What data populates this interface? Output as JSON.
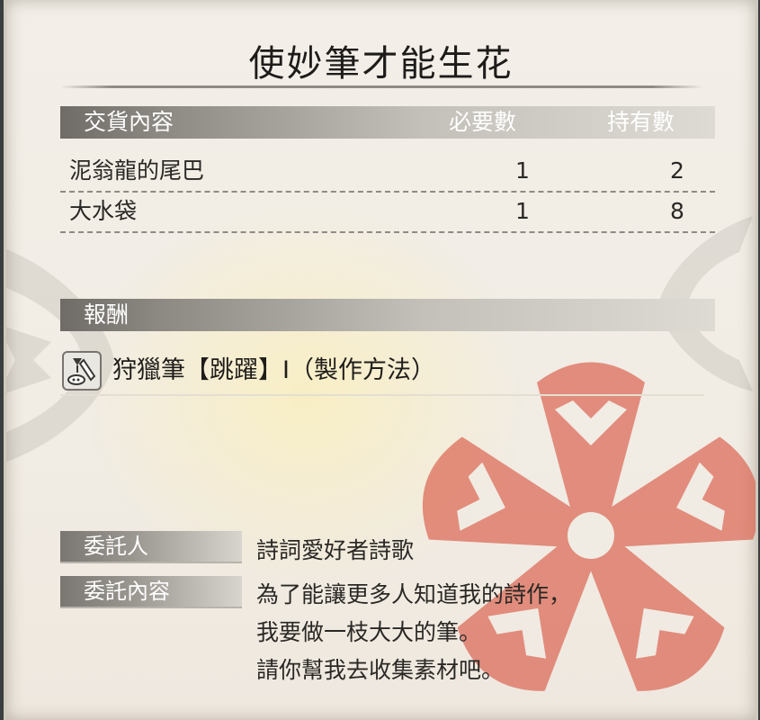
{
  "quest": {
    "title": "使妙筆才能生花"
  },
  "delivery": {
    "header_item": "交貨內容",
    "header_required": "必要數",
    "header_owned": "持有數",
    "rows": [
      {
        "item": "泥翁龍的尾巴",
        "required": "1",
        "owned": "2"
      },
      {
        "item": "大水袋",
        "required": "1",
        "owned": "8"
      }
    ]
  },
  "reward": {
    "header": "報酬",
    "item": "狩獵筆【跳躍】Ⅰ（製作方法）",
    "icon": "brush-recipe-icon"
  },
  "client": {
    "label": "委託人",
    "value": "詩詞愛好者詩歌"
  },
  "request": {
    "label": "委託內容",
    "lines": [
      "為了能讓更多人知道我的詩作，",
      "我要做一枝大大的筆。",
      "請你幫我去收集素材吧。"
    ]
  },
  "colors": {
    "parchment": "#f2ede6",
    "header_bar": "#8c8882",
    "emblem_red": "#d9533f",
    "text": "#2a2825"
  }
}
